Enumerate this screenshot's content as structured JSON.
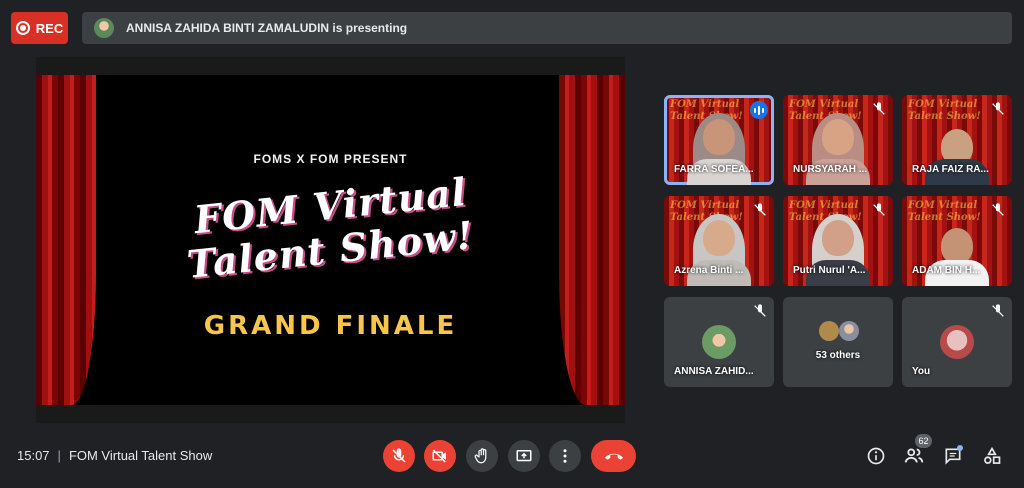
{
  "top_bar": {
    "rec_label": "REC",
    "presenting_text": "ANNISA ZAHIDA BINTI ZAMALUDIN is presenting"
  },
  "slide": {
    "subtitle": "FOMS X FOM PRESENT",
    "title_line1": "FOM Virtual",
    "title_line2": "Talent Show!",
    "finale": "GRAND FINALE"
  },
  "tile_banner": "FOM Virtual Talent Show!",
  "participants": [
    {
      "name": "FARRA SOFEA...",
      "speaking": true
    },
    {
      "name": "NURSYARAH ...",
      "muted": true
    },
    {
      "name": "RAJA FAIZ RA...",
      "muted": true
    },
    {
      "name": "Azrena Binti ...",
      "muted": true
    },
    {
      "name": "Putri Nurul 'A...",
      "muted": true
    },
    {
      "name": "ADAM BIN H...",
      "muted": true
    },
    {
      "name": "ANNISA ZAHID...",
      "muted": true
    },
    {
      "name": "53 others"
    },
    {
      "name": "You",
      "muted": true
    }
  ],
  "bottom_bar": {
    "time": "15:07",
    "separator": "|",
    "meeting_title": "FOM Virtual Talent Show",
    "participant_count": "62"
  },
  "colors": {
    "background": "#202124",
    "danger": "#ea4335",
    "rec": "#d93025",
    "accent": "#8ab4f8",
    "speaking": "#1a73e8",
    "finale_text": "#f7c64a"
  },
  "icons": {
    "mic": "mic-off-icon",
    "camera": "camera-off-icon",
    "hand": "raise-hand-icon",
    "present": "present-screen-icon",
    "more": "more-options-icon",
    "end": "end-call-icon",
    "info": "info-icon",
    "people": "people-icon",
    "chat": "chat-icon",
    "activities": "activities-icon"
  }
}
